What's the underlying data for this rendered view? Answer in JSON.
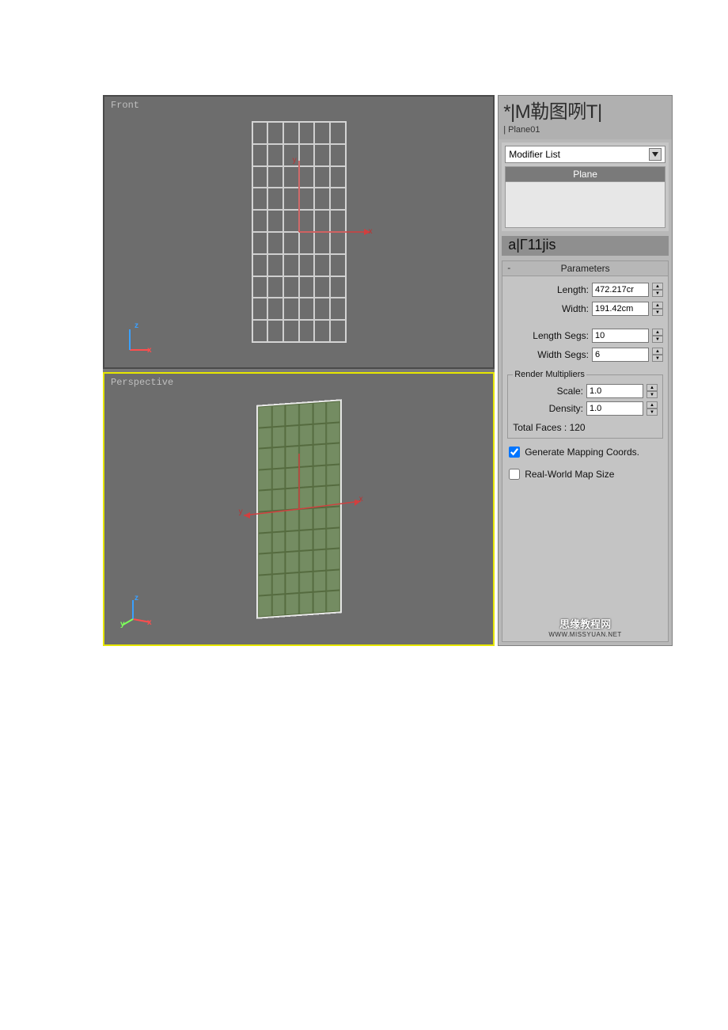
{
  "viewports": {
    "front_label": "Front",
    "persp_label": "Perspective"
  },
  "panel": {
    "title": "*|M勒图咧T|",
    "object_name": "| Plane01",
    "modifier_list_label": "Modifier List",
    "active_modifier": "Plane",
    "sub_header": "a|Γ11jis",
    "rollout_title": "Parameters",
    "collapse_char": "-",
    "params": {
      "length_label": "Length:",
      "length_value": "472.217cr",
      "width_label": "Width:",
      "width_value": "191.42cm",
      "length_segs_label": "Length Segs:",
      "length_segs_value": "10",
      "width_segs_label": "Width Segs:",
      "width_segs_value": "6",
      "render_mult_legend": "Render Multipliers",
      "scale_label": "Scale:",
      "scale_value": "1.0",
      "density_label": "Density:",
      "density_value": "1.0",
      "total_faces": "Total Faces : 120",
      "gen_map_label": "Generate Mapping Coords.",
      "realworld_label": "Real-World Map Size"
    },
    "watermark": {
      "line1": "思缘教程网",
      "line2": "WWW.MISSYUAN.NET"
    }
  }
}
